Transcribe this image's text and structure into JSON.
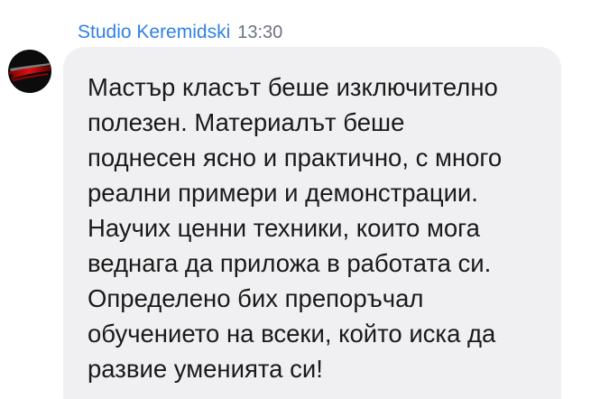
{
  "message": {
    "sender": "Studio Keremidski",
    "time": "13:30",
    "avatar_icon": "studio-logo",
    "text": " Мастър класът беше изключително\nполезен. Материалът беше\nподнесен ясно и практично, с много\nреални примери и демонстрации.\nНаучих ценни техники, които мога\nведнага да приложа в работата си.\nОпределено бих препоръчал\nобучението на всеки, който иска да\nразвие уменията си!"
  },
  "colors": {
    "sender": "#2f80e8",
    "time": "#6b7280",
    "bubble": "#f0f0f2",
    "text": "#1a1a1a"
  }
}
